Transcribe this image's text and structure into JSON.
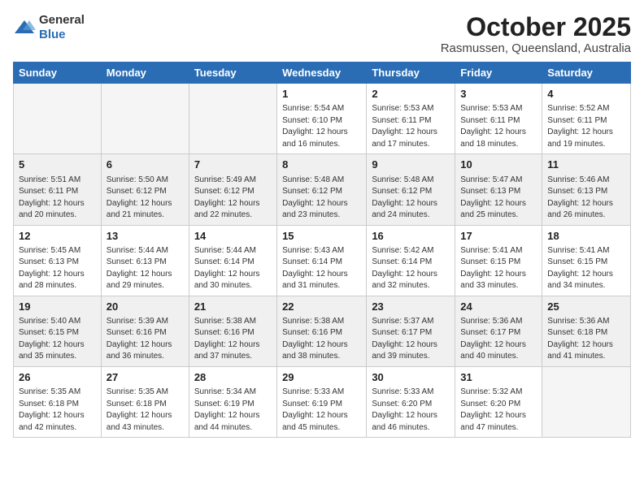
{
  "header": {
    "logo_general": "General",
    "logo_blue": "Blue",
    "month": "October 2025",
    "location": "Rasmussen, Queensland, Australia"
  },
  "weekdays": [
    "Sunday",
    "Monday",
    "Tuesday",
    "Wednesday",
    "Thursday",
    "Friday",
    "Saturday"
  ],
  "weeks": [
    [
      {
        "day": "",
        "info": ""
      },
      {
        "day": "",
        "info": ""
      },
      {
        "day": "",
        "info": ""
      },
      {
        "day": "1",
        "info": "Sunrise: 5:54 AM\nSunset: 6:10 PM\nDaylight: 12 hours\nand 16 minutes."
      },
      {
        "day": "2",
        "info": "Sunrise: 5:53 AM\nSunset: 6:11 PM\nDaylight: 12 hours\nand 17 minutes."
      },
      {
        "day": "3",
        "info": "Sunrise: 5:53 AM\nSunset: 6:11 PM\nDaylight: 12 hours\nand 18 minutes."
      },
      {
        "day": "4",
        "info": "Sunrise: 5:52 AM\nSunset: 6:11 PM\nDaylight: 12 hours\nand 19 minutes."
      }
    ],
    [
      {
        "day": "5",
        "info": "Sunrise: 5:51 AM\nSunset: 6:11 PM\nDaylight: 12 hours\nand 20 minutes."
      },
      {
        "day": "6",
        "info": "Sunrise: 5:50 AM\nSunset: 6:12 PM\nDaylight: 12 hours\nand 21 minutes."
      },
      {
        "day": "7",
        "info": "Sunrise: 5:49 AM\nSunset: 6:12 PM\nDaylight: 12 hours\nand 22 minutes."
      },
      {
        "day": "8",
        "info": "Sunrise: 5:48 AM\nSunset: 6:12 PM\nDaylight: 12 hours\nand 23 minutes."
      },
      {
        "day": "9",
        "info": "Sunrise: 5:48 AM\nSunset: 6:12 PM\nDaylight: 12 hours\nand 24 minutes."
      },
      {
        "day": "10",
        "info": "Sunrise: 5:47 AM\nSunset: 6:13 PM\nDaylight: 12 hours\nand 25 minutes."
      },
      {
        "day": "11",
        "info": "Sunrise: 5:46 AM\nSunset: 6:13 PM\nDaylight: 12 hours\nand 26 minutes."
      }
    ],
    [
      {
        "day": "12",
        "info": "Sunrise: 5:45 AM\nSunset: 6:13 PM\nDaylight: 12 hours\nand 28 minutes."
      },
      {
        "day": "13",
        "info": "Sunrise: 5:44 AM\nSunset: 6:13 PM\nDaylight: 12 hours\nand 29 minutes."
      },
      {
        "day": "14",
        "info": "Sunrise: 5:44 AM\nSunset: 6:14 PM\nDaylight: 12 hours\nand 30 minutes."
      },
      {
        "day": "15",
        "info": "Sunrise: 5:43 AM\nSunset: 6:14 PM\nDaylight: 12 hours\nand 31 minutes."
      },
      {
        "day": "16",
        "info": "Sunrise: 5:42 AM\nSunset: 6:14 PM\nDaylight: 12 hours\nand 32 minutes."
      },
      {
        "day": "17",
        "info": "Sunrise: 5:41 AM\nSunset: 6:15 PM\nDaylight: 12 hours\nand 33 minutes."
      },
      {
        "day": "18",
        "info": "Sunrise: 5:41 AM\nSunset: 6:15 PM\nDaylight: 12 hours\nand 34 minutes."
      }
    ],
    [
      {
        "day": "19",
        "info": "Sunrise: 5:40 AM\nSunset: 6:15 PM\nDaylight: 12 hours\nand 35 minutes."
      },
      {
        "day": "20",
        "info": "Sunrise: 5:39 AM\nSunset: 6:16 PM\nDaylight: 12 hours\nand 36 minutes."
      },
      {
        "day": "21",
        "info": "Sunrise: 5:38 AM\nSunset: 6:16 PM\nDaylight: 12 hours\nand 37 minutes."
      },
      {
        "day": "22",
        "info": "Sunrise: 5:38 AM\nSunset: 6:16 PM\nDaylight: 12 hours\nand 38 minutes."
      },
      {
        "day": "23",
        "info": "Sunrise: 5:37 AM\nSunset: 6:17 PM\nDaylight: 12 hours\nand 39 minutes."
      },
      {
        "day": "24",
        "info": "Sunrise: 5:36 AM\nSunset: 6:17 PM\nDaylight: 12 hours\nand 40 minutes."
      },
      {
        "day": "25",
        "info": "Sunrise: 5:36 AM\nSunset: 6:18 PM\nDaylight: 12 hours\nand 41 minutes."
      }
    ],
    [
      {
        "day": "26",
        "info": "Sunrise: 5:35 AM\nSunset: 6:18 PM\nDaylight: 12 hours\nand 42 minutes."
      },
      {
        "day": "27",
        "info": "Sunrise: 5:35 AM\nSunset: 6:18 PM\nDaylight: 12 hours\nand 43 minutes."
      },
      {
        "day": "28",
        "info": "Sunrise: 5:34 AM\nSunset: 6:19 PM\nDaylight: 12 hours\nand 44 minutes."
      },
      {
        "day": "29",
        "info": "Sunrise: 5:33 AM\nSunset: 6:19 PM\nDaylight: 12 hours\nand 45 minutes."
      },
      {
        "day": "30",
        "info": "Sunrise: 5:33 AM\nSunset: 6:20 PM\nDaylight: 12 hours\nand 46 minutes."
      },
      {
        "day": "31",
        "info": "Sunrise: 5:32 AM\nSunset: 6:20 PM\nDaylight: 12 hours\nand 47 minutes."
      },
      {
        "day": "",
        "info": ""
      }
    ]
  ]
}
